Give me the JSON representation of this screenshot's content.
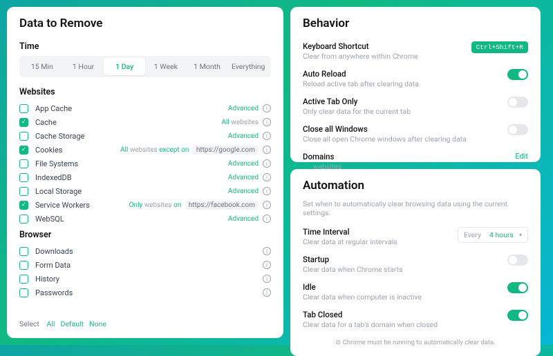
{
  "left": {
    "title": "Data to Remove",
    "time_label": "Time",
    "time_options": [
      "15 Min",
      "1 Hour",
      "1 Day",
      "1 Week",
      "1 Month",
      "Everything"
    ],
    "time_active": 2,
    "websites_label": "Websites",
    "websites": [
      {
        "label": "App Cache",
        "checked": false,
        "meta_html": "<span class='adv'>Advanced</span>"
      },
      {
        "label": "Cache",
        "checked": true,
        "meta_html": "<span class='g'>All</span> websites"
      },
      {
        "label": "Cache Storage",
        "checked": false,
        "meta_html": "<span class='adv'>Advanced</span>"
      },
      {
        "label": "Cookies",
        "checked": true,
        "meta_html": "<span class='g'>All</span> websites <span class='g'>except on</span> <span class='chip'>https://google.com</span>"
      },
      {
        "label": "File Systems",
        "checked": false,
        "meta_html": "<span class='adv'>Advanced</span>"
      },
      {
        "label": "IndexedDB",
        "checked": false,
        "meta_html": "<span class='adv'>Advanced</span>"
      },
      {
        "label": "Local Storage",
        "checked": false,
        "meta_html": "<span class='adv'>Advanced</span>"
      },
      {
        "label": "Service Workers",
        "checked": true,
        "meta_html": "<span class='g'>Only</span> websites <span class='g'>on</span> <span class='chip'>https://facebook.com</span>"
      },
      {
        "label": "WebSQL",
        "checked": false,
        "meta_html": "<span class='adv'>Advanced</span>"
      }
    ],
    "browser_label": "Browser",
    "browser": [
      {
        "label": "Downloads",
        "checked": false
      },
      {
        "label": "Form Data",
        "checked": false
      },
      {
        "label": "History",
        "checked": false
      },
      {
        "label": "Passwords",
        "checked": false
      }
    ],
    "select_label": "Select",
    "select_links": [
      "All",
      "Default",
      "None"
    ]
  },
  "behavior": {
    "title": "Behavior",
    "items": [
      {
        "title": "Keyboard Shortcut",
        "sub": "Clear from anywhere within Chrome",
        "kbd": "Ctrl+Shift+R"
      },
      {
        "title": "Auto Reload",
        "sub": "Reload active tab after clearing data",
        "toggle": true
      },
      {
        "title": "Active Tab Only",
        "sub": "Only clear data for the current tab",
        "toggle": false
      },
      {
        "title": "Close all Windows",
        "sub": "Close all open Chrome windows after clearing data",
        "toggle": false
      },
      {
        "title": "Domains",
        "sub_html": "<span class='g' style='color:#10b981'>All</span> websites",
        "edit": "Edit"
      }
    ]
  },
  "automation": {
    "title": "Automation",
    "subtitle": "Set when to automatically clear browsing data using the current settings.",
    "items": [
      {
        "title": "Time Interval",
        "sub": "Clear data at regular intervals",
        "dropdown": {
          "prefix": "Every",
          "value": "4 hours"
        }
      },
      {
        "title": "Startup",
        "sub": "Clear data when Chrome starts",
        "toggle": false
      },
      {
        "title": "Idle",
        "sub": "Clear data when computer is inactive",
        "toggle": true
      },
      {
        "title": "Tab Closed",
        "sub": "Clear data for a tab's domain when closed",
        "toggle": true
      }
    ],
    "footer": "Chrome must be running to automatically clear data."
  }
}
